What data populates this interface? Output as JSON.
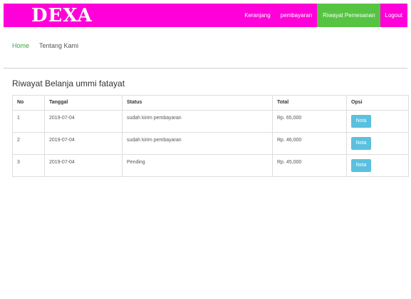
{
  "navbar": {
    "brand": "DEXA",
    "links": [
      "Keranjang",
      "pembayaran",
      "Riwayat Pemesanan",
      "Logout"
    ],
    "active": "Riwayat Pemesanan",
    "bg_color": "#ff00d8",
    "active_color": "#56c442"
  },
  "subnav": {
    "home": "Home",
    "about": "Tentang Kami"
  },
  "page": {
    "title": "Riwayat Belanja ummi fatayat"
  },
  "table": {
    "headers": [
      "No",
      "Tanggal",
      "Status",
      "Total",
      "Opsi"
    ],
    "rows": [
      {
        "no": "1",
        "tanggal": "2019-07-04",
        "status": "sudah kirim pembayaran",
        "total": "Rp. 65,000",
        "action": "Nota"
      },
      {
        "no": "2",
        "tanggal": "2019-07-04",
        "status": "sudah kirim pembayaran",
        "total": "Rp. 46,000",
        "action": "Nota"
      },
      {
        "no": "3",
        "tanggal": "2019-07-04",
        "status": "Pending",
        "total": "Rp. 45,000",
        "action": "Nota"
      }
    ],
    "button_color": "#5bc0de"
  }
}
